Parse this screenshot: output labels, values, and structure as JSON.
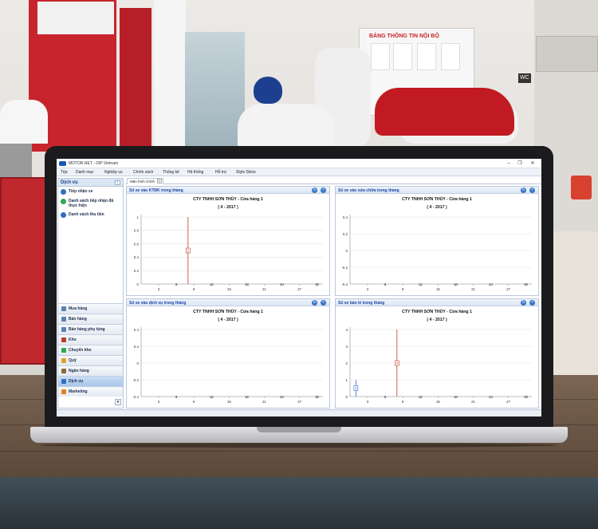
{
  "window": {
    "title": "MOTOR.NET - DIP Vietnam"
  },
  "menu": [
    "Tệp",
    "Danh mục",
    "Nghiệp vụ",
    "Chính sách",
    "Thống kê",
    "Hệ thống",
    "Hỗ trợ",
    "Style Skins"
  ],
  "tabs": [
    {
      "label": "Màn hình chính"
    }
  ],
  "sidebar": {
    "header": "Dịch vụ",
    "service_items": [
      {
        "label": "Tiếp nhận xe",
        "icon": "service-icon"
      },
      {
        "label": "Danh sách tiếp nhận đã thực hiện",
        "icon": "check-icon"
      },
      {
        "label": "Danh sách thu tiền",
        "icon": "payment-icon"
      }
    ],
    "modules": [
      {
        "label": "Mua hàng",
        "icon": "cart-icon"
      },
      {
        "label": "Bán hàng",
        "icon": "sales-icon"
      },
      {
        "label": "Bán hàng phụ tùng",
        "icon": "parts-icon"
      },
      {
        "label": "Kho",
        "icon": "warehouse-icon"
      },
      {
        "label": "Chuyển kho",
        "icon": "transfer-icon"
      },
      {
        "label": "Quỹ",
        "icon": "fund-icon"
      },
      {
        "label": "Ngân hàng",
        "icon": "bank-icon"
      },
      {
        "label": "Dịch vụ",
        "icon": "service-icon",
        "active": true
      },
      {
        "label": "Marketing",
        "icon": "marketing-icon"
      }
    ]
  },
  "background": {
    "board_title": "BẢNG THÔNG TIN NỘI BỘ",
    "wc_sign": "WC"
  },
  "chart_data": [
    {
      "type": "line",
      "panel_title": "Số xe vào KTĐK trong tháng",
      "title": "CTY TNHH SƠN THỦY - Cửa hàng 1",
      "subtitle": "( 4 - 2017 )",
      "x_ticks": [
        3,
        6,
        9,
        12,
        15,
        18,
        21,
        24,
        27,
        30
      ],
      "y_ticks": [
        "1",
        "0.8",
        "0.6",
        "0.4",
        "0.2",
        "0"
      ],
      "xlim": [
        0,
        31
      ],
      "ylim": [
        0,
        1
      ],
      "points": [
        {
          "x": 8,
          "y": 1,
          "label": "1"
        }
      ],
      "series_color": "#c0392b"
    },
    {
      "type": "line",
      "panel_title": "Số xe vào sửa chữa trong tháng",
      "title": "CTY TNHH SƠN THỦY - Cửa hàng 1",
      "subtitle": "( 4 - 2017 )",
      "x_ticks": [
        3,
        6,
        9,
        12,
        15,
        18,
        21,
        24,
        27,
        30
      ],
      "y_ticks": [
        "0.4",
        "0.2",
        "0",
        "-0.2",
        "-0.4"
      ],
      "xlim": [
        0,
        31
      ],
      "ylim": [
        -0.5,
        0.5
      ],
      "points": [],
      "series_color": "#c0392b"
    },
    {
      "type": "line",
      "panel_title": "Số xe vào dịch vụ trong tháng",
      "title": "CTY TNHH SƠN THỦY - Cửa hàng 1",
      "subtitle": "( 4 - 2017 )",
      "x_ticks": [
        3,
        6,
        9,
        12,
        15,
        18,
        21,
        24,
        27,
        30
      ],
      "y_ticks": [
        "0.4",
        "0.2",
        "0",
        "-0.2",
        "-0.4"
      ],
      "xlim": [
        0,
        31
      ],
      "ylim": [
        -0.5,
        0.5
      ],
      "points": [],
      "series_color": "#c0392b"
    },
    {
      "type": "line",
      "panel_title": "Số xe bán lẻ trong tháng",
      "title": "CTY TNHH SƠN THỦY - Cửa hàng 1",
      "subtitle": "( 4 - 2017 )",
      "x_ticks": [
        3,
        6,
        9,
        12,
        15,
        18,
        21,
        24,
        27,
        30
      ],
      "y_ticks": [
        "4",
        "3",
        "2",
        "1",
        "0"
      ],
      "xlim": [
        0,
        31
      ],
      "ylim": [
        0,
        4
      ],
      "points": [
        {
          "x": 1,
          "y": 1,
          "label": "1",
          "color": "#2e6fc0"
        },
        {
          "x": 8,
          "y": 4,
          "label": "4",
          "color": "#c0392b"
        }
      ],
      "series_color": "#c0392b"
    }
  ]
}
